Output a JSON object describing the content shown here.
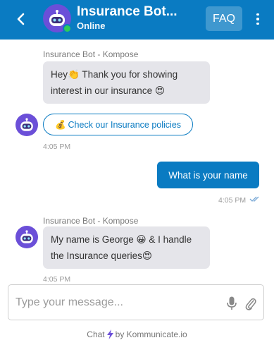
{
  "header": {
    "title": "Insurance Bot...",
    "status": "Online",
    "faq_label": "FAQ"
  },
  "messages": [
    {
      "sender": "Insurance Bot - Kompose",
      "line1": "Hey👏 Thank you for showing",
      "line2": "interest in our insurance 😍"
    },
    {
      "quick_reply_emoji": "💰",
      "quick_reply": "Check our Insurance policies",
      "time": "4:05 PM"
    },
    {
      "user_text": "What is your name",
      "time": "4:05 PM"
    },
    {
      "sender": "Insurance Bot - Kompose",
      "line1": "My name is George 😀  & I handle",
      "line2": "the Insurance queries😍",
      "time": "4:05 PM"
    }
  ],
  "composer": {
    "placeholder": "Type your message..."
  },
  "footer": {
    "chat": "Chat",
    "by": "by Kommunicate.io"
  },
  "colors": {
    "brand": "#0a7bc2",
    "bot_bubble": "#e5e5ea",
    "online": "#2ecc5a",
    "avatar": "#6b4fd8"
  },
  "icons": {
    "back": "chevron-left-icon",
    "more": "more-vertical-icon",
    "mic": "microphone-icon",
    "attach": "paperclip-icon",
    "read": "double-check-icon",
    "bolt": "lightning-icon"
  }
}
